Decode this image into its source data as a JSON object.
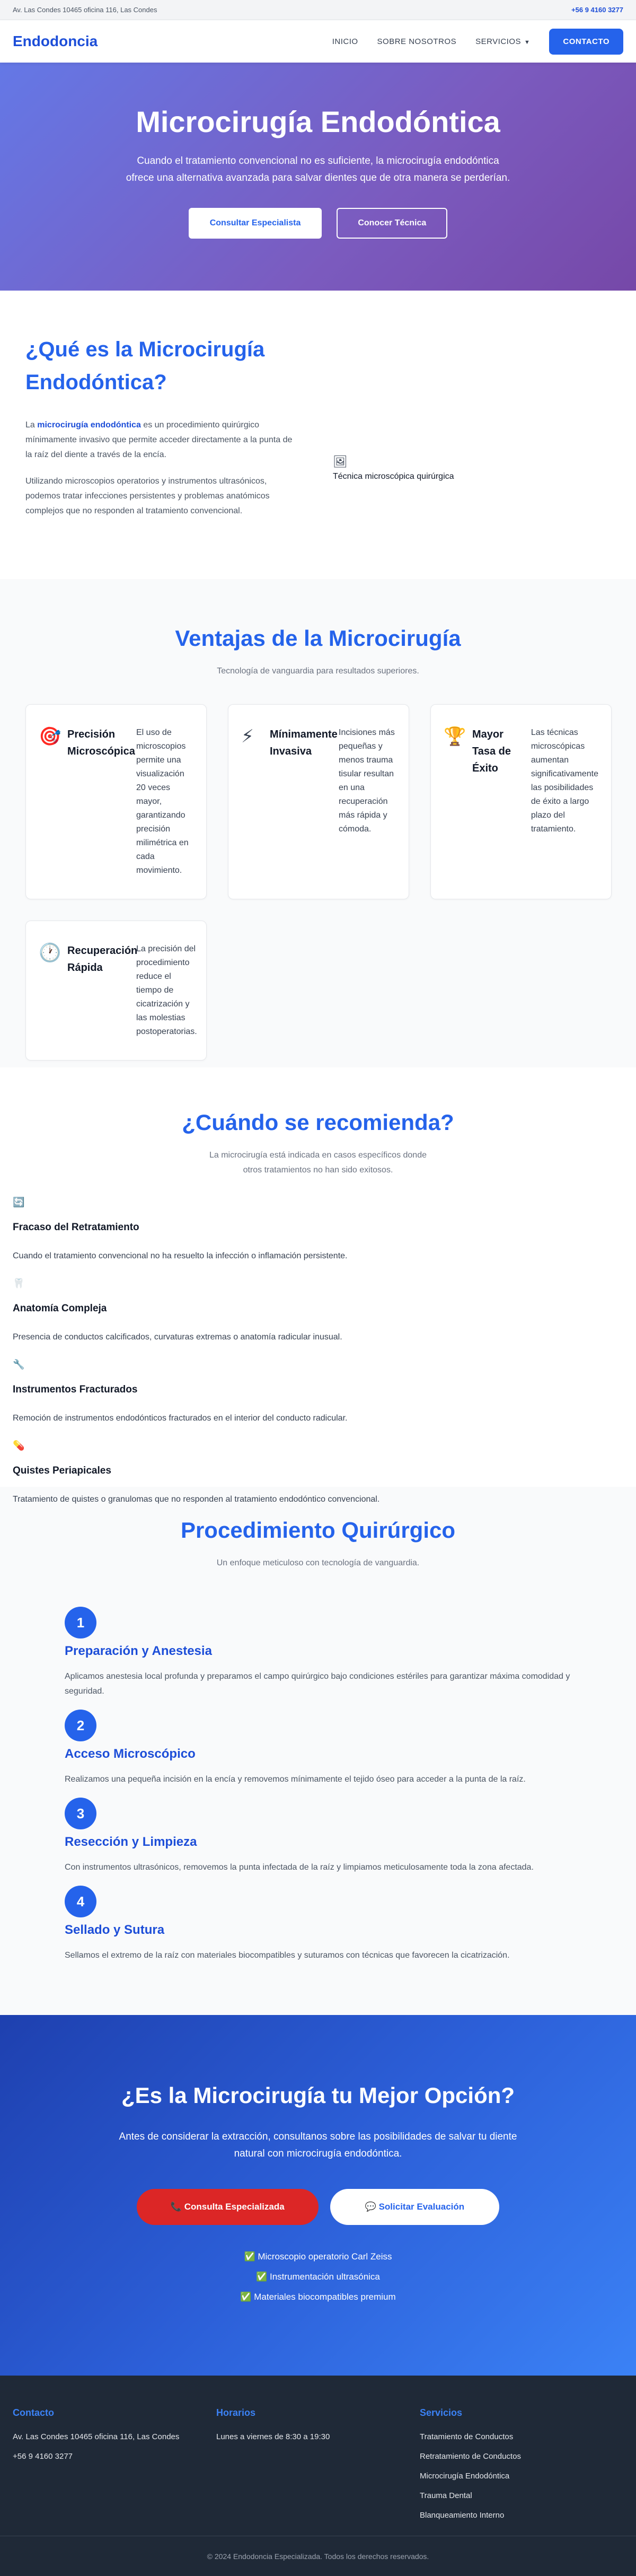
{
  "topbar": {
    "address": "Av. Las Condes 10465 oficina 116, Las Condes",
    "phone": "+56 9 4160 3277"
  },
  "header": {
    "logo": "Endodoncia",
    "nav": {
      "inicio": "INICIO",
      "sobre": "SOBRE NOSOTROS",
      "servicios": "SERVICIOS",
      "caret": "▼",
      "contacto": "CONTACTO"
    }
  },
  "hero": {
    "title": "Microcirugía Endodóntica",
    "text": "Cuando el tratamiento convencional no es suficiente, la microcirugía endodóntica ofrece una alternativa avanzada para salvar dientes que de otra manera se perderían.",
    "btn_primary": "Consultar Especialista",
    "btn_secondary": "Conocer Técnica"
  },
  "what": {
    "title": "¿Qué es la Microcirugía Endodóntica?",
    "p1_pre": "La ",
    "p1_bold": "microcirugía endodóntica",
    "p1_post": " es un procedimiento quirúrgico mínimamente invasivo que permite acceder directamente a la punta de la raíz del diente a través de la encía.",
    "p2": "Utilizando microscopios operatorios y instrumentos ultrasónicos, podemos tratar infecciones persistentes y problemas anatómicos complejos que no responden al tratamiento convencional.",
    "image_icon": "🖼",
    "image_alt": "Técnica microscópica quirúrgica"
  },
  "advantages": {
    "title": "Ventajas de la Microcirugía",
    "subtitle": "Tecnología de vanguardia para resultados superiores.",
    "cards": [
      {
        "icon": "🎯",
        "title": "Precisión Microscópica",
        "text": "El uso de microscopios permite una visualización 20 veces mayor, garantizando precisión milimétrica en cada movimiento."
      },
      {
        "icon": "⚡",
        "title": "Mínimamente Invasiva",
        "text": "Incisiones más pequeñas y menos trauma tisular resultan en una recuperación más rápida y cómoda."
      },
      {
        "icon": "🏆",
        "title": "Mayor Tasa de Éxito",
        "text": "Las técnicas microscópicas aumentan significativamente las posibilidades de éxito a largo plazo del tratamiento."
      },
      {
        "icon": "🕐",
        "title": "Recuperación Rápida",
        "text": "La precisión del procedimiento reduce el tiempo de cicatrización y las molestias postoperatorias."
      }
    ]
  },
  "when": {
    "title": "¿Cuándo se recomienda?",
    "subtitle": "La microcirugía está indicada en casos específicos donde otros tratamientos no han sido exitosos.",
    "items": [
      {
        "icon": "🔄",
        "title": "Fracaso del Retratamiento",
        "text": "Cuando el tratamiento convencional no ha resuelto la infección o inflamación persistente."
      },
      {
        "icon": "🦷",
        "title": "Anatomía Compleja",
        "text": "Presencia de conductos calcificados, curvaturas extremas o anatomía radicular inusual."
      },
      {
        "icon": "🔧",
        "title": "Instrumentos Fracturados",
        "text": "Remoción de instrumentos endodónticos fracturados en el interior del conducto radicular."
      },
      {
        "icon": "💊",
        "title": "Quistes Periapicales",
        "text": "Tratamiento de quistes o granulomas que no responden al tratamiento endodóntico convencional."
      }
    ]
  },
  "procedure": {
    "title": "Procedimiento Quirúrgico",
    "subtitle": "Un enfoque meticuloso con tecnología de vanguardia.",
    "steps": [
      {
        "num": "1",
        "title": "Preparación y Anestesia",
        "text": "Aplicamos anestesia local profunda y preparamos el campo quirúrgico bajo condiciones estériles para garantizar máxima comodidad y seguridad."
      },
      {
        "num": "2",
        "title": "Acceso Microscópico",
        "text": "Realizamos una pequeña incisión en la encía y removemos mínimamente el tejido óseo para acceder a la punta de la raíz."
      },
      {
        "num": "3",
        "title": "Resección y Limpieza",
        "text": "Con instrumentos ultrasónicos, removemos la punta infectada de la raíz y limpiamos meticulosamente toda la zona afectada."
      },
      {
        "num": "4",
        "title": "Sellado y Sutura",
        "text": "Sellamos el extremo de la raíz con materiales biocompatibles y suturamos con técnicas que favorecen la cicatrización."
      }
    ]
  },
  "cta": {
    "title": "¿Es la Microcirugía tu Mejor Opción?",
    "text": "Antes de considerar la extracción, consultanos sobre las posibilidades de salvar tu diente natural con microcirugía endodóntica.",
    "btn_primary": "📞 Consulta Especializada",
    "btn_secondary": "💬 Solicitar Evaluación",
    "checks": [
      "✅ Microscopio operatorio Carl Zeiss",
      "✅ Instrumentación ultrasónica",
      "✅ Materiales biocompatibles premium"
    ]
  },
  "footer": {
    "contact_title": "Contacto",
    "contact_address": "Av. Las Condes 10465 oficina 116, Las Condes",
    "contact_phone": "+56 9 4160 3277",
    "hours_title": "Horarios",
    "hours_text": "Lunes a viernes de 8:30 a 19:30",
    "services_title": "Servicios",
    "services": [
      "Tratamiento de Conductos",
      "Retratamiento de Conductos",
      "Microcirugía Endodóntica",
      "Trauma Dental",
      "Blanqueamiento Interno"
    ],
    "copyright": "© 2024 Endodoncia Especializada. Todos los derechos reservados."
  }
}
